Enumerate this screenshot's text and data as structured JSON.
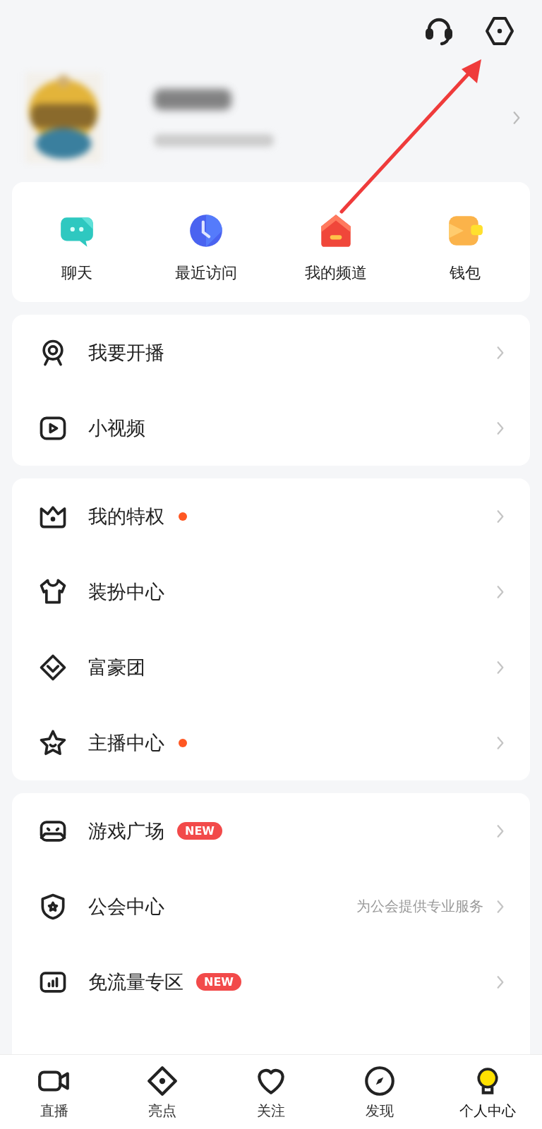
{
  "quick_actions": [
    {
      "label": "聊天"
    },
    {
      "label": "最近访问"
    },
    {
      "label": "我的频道"
    },
    {
      "label": "钱包"
    }
  ],
  "sections": [
    {
      "rows": [
        {
          "label": "我要开播",
          "dot": false
        },
        {
          "label": "小视频",
          "dot": false
        }
      ]
    },
    {
      "rows": [
        {
          "label": "我的特权",
          "dot": true
        },
        {
          "label": "装扮中心",
          "dot": false
        },
        {
          "label": "富豪团",
          "dot": false
        },
        {
          "label": "主播中心",
          "dot": true
        }
      ]
    },
    {
      "rows": [
        {
          "label": "游戏广场",
          "dot": false,
          "badge": "NEW"
        },
        {
          "label": "公会中心",
          "dot": false,
          "hint": "为公会提供专业服务"
        },
        {
          "label": "免流量专区",
          "dot": false,
          "badge": "NEW"
        }
      ]
    }
  ],
  "bottom_nav": [
    {
      "label": "直播",
      "selected": false
    },
    {
      "label": "亮点",
      "selected": false
    },
    {
      "label": "关注",
      "selected": false
    },
    {
      "label": "发现",
      "selected": false
    },
    {
      "label": "个人中心",
      "selected": true
    }
  ]
}
